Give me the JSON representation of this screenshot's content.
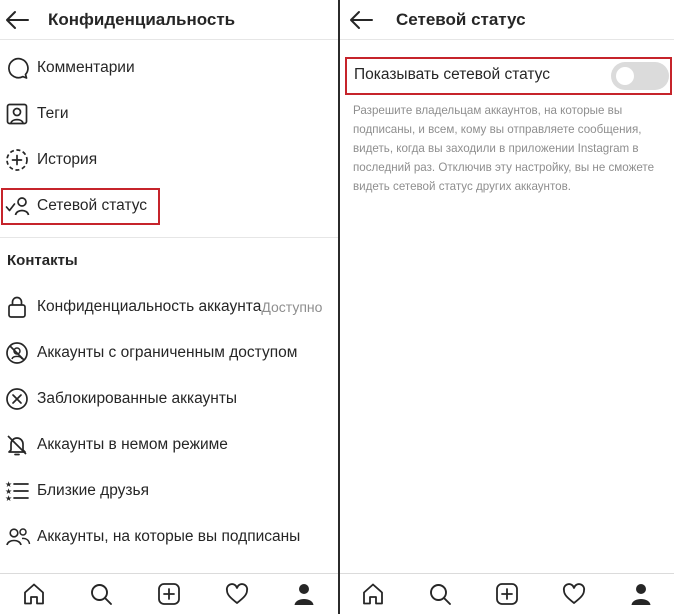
{
  "left_panel": {
    "title": "Конфиденциальность",
    "items": [
      {
        "label": "Комментарии",
        "icon": "comment-icon"
      },
      {
        "label": "Теги",
        "icon": "tag-user-icon"
      },
      {
        "label": "История",
        "icon": "story-add-icon"
      },
      {
        "label": "Сетевой статус",
        "icon": "activity-status-icon"
      }
    ],
    "contacts_section": {
      "title": "Контакты",
      "items": [
        {
          "label": "Конфиденциальность аккаунта",
          "value": "Доступно",
          "icon": "lock-icon"
        },
        {
          "label": "Аккаунты с ограниченным доступом",
          "icon": "restricted-icon"
        },
        {
          "label": "Заблокированные аккаунты",
          "icon": "blocked-icon"
        },
        {
          "label": "Аккаунты в немом режиме",
          "icon": "muted-bell-icon"
        },
        {
          "label": "Близкие друзья",
          "icon": "close-friends-icon"
        },
        {
          "label": "Аккаунты, на которые вы подписаны",
          "icon": "following-icon"
        }
      ]
    }
  },
  "right_panel": {
    "title": "Сетевой статус",
    "setting_label": "Показывать сетевой статус",
    "toggle_on": false,
    "description": "Разрешите владельцам аккаунтов, на которые вы подписаны, и всем, кому вы отправляете сообщения, видеть, когда вы заходили в приложении Instagram в последний раз. Отключив эту настройку, вы не сможете видеть сетевой статус других аккаунтов."
  },
  "tabbar": [
    "home-icon",
    "search-icon",
    "new-post-icon",
    "activity-heart-icon",
    "profile-icon"
  ],
  "colors": {
    "highlight": "#c6242b",
    "text": "#262626",
    "secondary": "#8e8e8e",
    "toggle_off": "#dbdbdb"
  }
}
